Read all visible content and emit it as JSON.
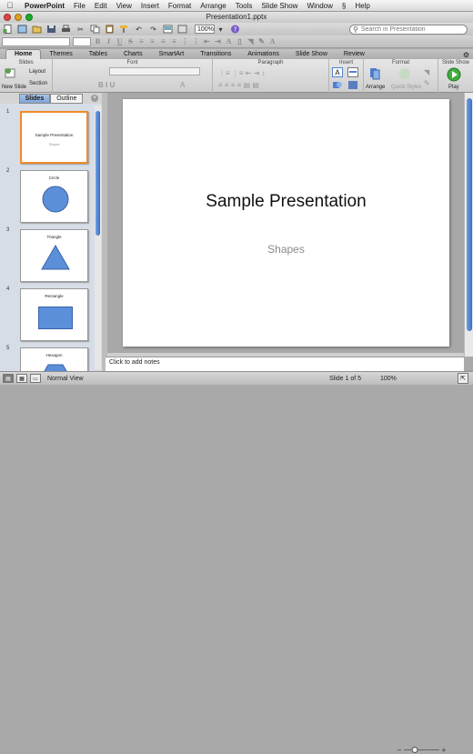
{
  "menubar": {
    "app": "PowerPoint",
    "items": [
      "File",
      "Edit",
      "View",
      "Insert",
      "Format",
      "Arrange",
      "Tools",
      "Slide Show",
      "Window",
      "Help"
    ]
  },
  "window": {
    "title": "Presentation1.pptx"
  },
  "toolbar": {
    "zoom": "100%",
    "search_placeholder": "Search in Presentation"
  },
  "ribbon": {
    "tabs": [
      "Home",
      "Themes",
      "Tables",
      "Charts",
      "SmartArt",
      "Transitions",
      "Animations",
      "Slide Show",
      "Review"
    ],
    "active_tab": "Home",
    "groups": {
      "slides": {
        "title": "Slides",
        "new_slide": "New Slide",
        "layout": "Layout",
        "section": "Section"
      },
      "font": {
        "title": "Font"
      },
      "paragraph": {
        "title": "Paragraph"
      },
      "insert": {
        "title": "Insert"
      },
      "format": {
        "title": "Format",
        "arrange": "Arrange",
        "quick_styles": "Quick Styles"
      },
      "slideshow": {
        "title": "Slide Show",
        "play": "Play"
      }
    }
  },
  "panel": {
    "tabs": [
      "Slides",
      "Outline"
    ],
    "active_tab": "Slides"
  },
  "slides": [
    {
      "num": "1",
      "title": "Sample Presentation",
      "subtitle": "Shapes",
      "shape": "none",
      "selected": true
    },
    {
      "num": "2",
      "title": "Circle",
      "shape": "circle"
    },
    {
      "num": "3",
      "title": "Triangle",
      "shape": "triangle"
    },
    {
      "num": "4",
      "title": "Rectangle",
      "shape": "rectangle"
    },
    {
      "num": "5",
      "title": "Hexagon",
      "shape": "hexagon"
    }
  ],
  "main_slide": {
    "title": "Sample Presentation",
    "subtitle": "Shapes"
  },
  "notes": {
    "placeholder": "Click to add notes"
  },
  "status": {
    "view": "Normal View",
    "slide": "Slide 1 of 5",
    "zoom": "100%"
  },
  "colors": {
    "accent": "#4f81d4",
    "shape_fill": "#5b8fd9",
    "selection": "#f08b2a"
  }
}
